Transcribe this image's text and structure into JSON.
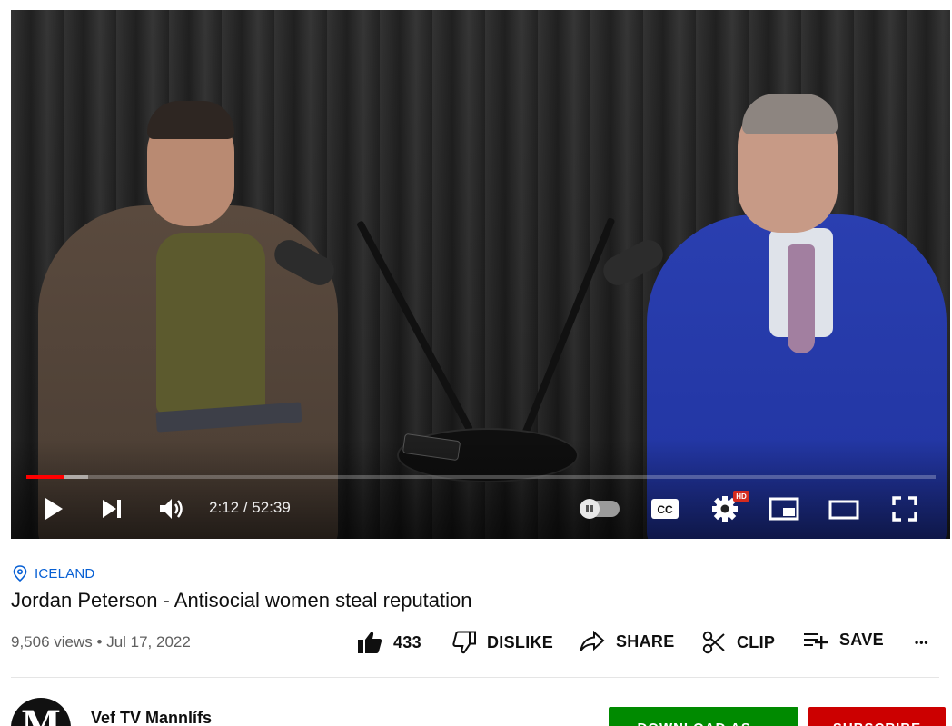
{
  "player": {
    "progress_played_fraction": 0.042,
    "progress_buffered_fraction": 0.068,
    "time_current": "2:12",
    "time_separator": " / ",
    "time_total": "52:39",
    "quality_badge": "HD",
    "icons": [
      "play-icon",
      "next-icon",
      "volume-icon",
      "autoplay-toggle",
      "captions-icon",
      "settings-icon",
      "miniplayer-icon",
      "theater-icon",
      "fullscreen-icon"
    ],
    "progress_color": "#ff0000"
  },
  "video": {
    "location": "ICELAND",
    "title": "Jordan Peterson - Antisocial women steal reputation",
    "views": "9,506 views",
    "separator": " • ",
    "date": "Jul 17, 2022"
  },
  "actions": {
    "like_count": "433",
    "dislike_label": "DISLIKE",
    "share_label": "SHARE",
    "clip_label": "CLIP",
    "save_label": "SAVE",
    "more_label": "•••"
  },
  "channel": {
    "avatar_letter": "M",
    "name": "Vef TV Mannlífs",
    "download_label": "DOWNLOAD AS ...",
    "subscribe_label": "SUBSCRIBE"
  },
  "colors": {
    "link": "#065fd4",
    "download": "#008a00",
    "subscribe": "#cc0000"
  }
}
